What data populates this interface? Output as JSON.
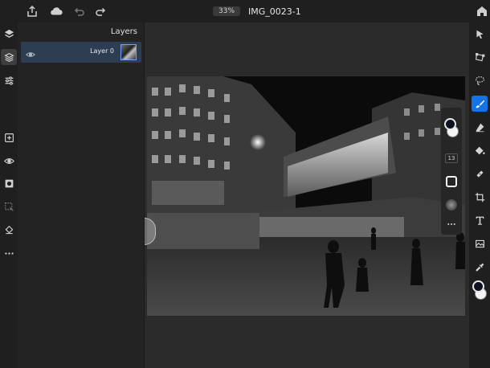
{
  "topbar": {
    "document_title": "IMG_0023-1",
    "zoom": "33%",
    "icons": [
      "home-icon",
      "share-icon",
      "cloud-icon",
      "undo-icon",
      "redo-icon"
    ]
  },
  "layers_panel": {
    "title": "Layers",
    "layers": [
      {
        "name": "Layer 0",
        "visible": true,
        "selected": true
      }
    ]
  },
  "brush_panel": {
    "brush_size": "13"
  },
  "colors": {
    "accent": "#1473e6",
    "foreground": "#0d1220",
    "background": "#f4f4f4",
    "selected_layer_bg": "#2d3d52"
  },
  "left_toolbar": {
    "icons": [
      "layers-icon",
      "layer-properties-icon",
      "adjustments-icon",
      "add-layer-icon",
      "visibility-icon",
      "mask-icon",
      "select-icon",
      "fill-icon",
      "more-icon"
    ]
  },
  "right_toolbar": {
    "icons": [
      "move-icon",
      "transform-icon",
      "lasso-icon",
      "brush-icon",
      "eraser-icon",
      "fill-bucket-icon",
      "healing-icon",
      "crop-icon",
      "type-icon",
      "place-image-icon",
      "eyedropper-icon"
    ]
  }
}
